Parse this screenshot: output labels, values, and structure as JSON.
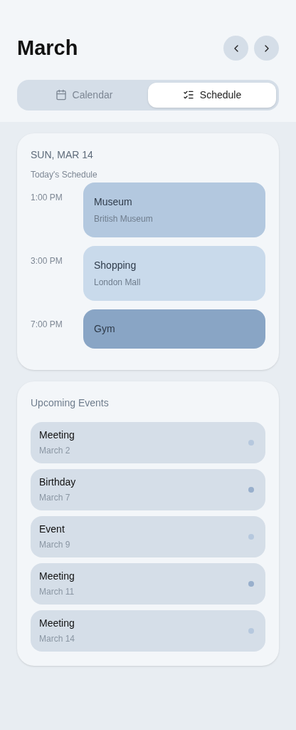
{
  "header": {
    "title": "March"
  },
  "tabs": [
    {
      "label": "Calendar",
      "kind": "calendar",
      "selected": false
    },
    {
      "label": "Schedule",
      "kind": "schedule",
      "selected": true
    }
  ],
  "today": {
    "date": "SUN, MAR 14",
    "subtitle": "Today's Schedule",
    "events": [
      {
        "time": "1:00 PM",
        "title": "Museum",
        "place": "British Museum",
        "color": "#b3c8df"
      },
      {
        "time": "3:00 PM",
        "title": "Shopping",
        "place": "London Mall",
        "color": "#c9daeb"
      },
      {
        "time": "7:00 PM",
        "title": "Gym",
        "color": "#89a5c5"
      }
    ]
  },
  "upcoming": {
    "title": "Upcoming Events",
    "items": [
      {
        "title": "Meeting",
        "date": "March 2",
        "color": "#b6c8de"
      },
      {
        "title": "Birthday",
        "date": "March 7",
        "color": "#98afcc"
      },
      {
        "title": "Event",
        "date": "March 9",
        "color": "#b6c8de"
      },
      {
        "title": "Meeting",
        "date": "March 11",
        "color": "#98afcc"
      },
      {
        "title": "Meeting",
        "date": "March 14",
        "color": "#b6c8de"
      }
    ]
  }
}
